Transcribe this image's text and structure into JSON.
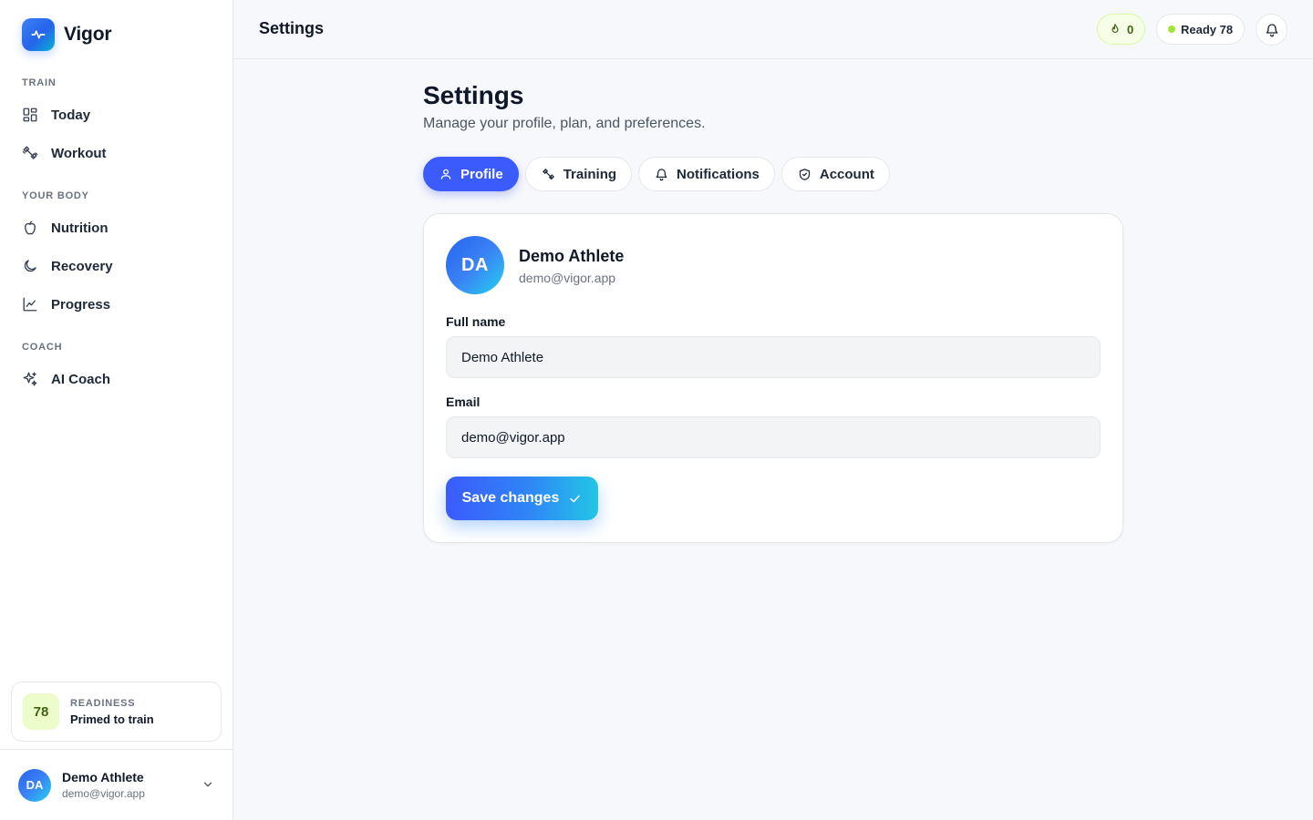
{
  "brand": {
    "name": "Vigor",
    "logo_icon": "pulse-icon"
  },
  "sidebar": {
    "sections": [
      {
        "label": "TRAIN",
        "items": [
          {
            "label": "Today",
            "icon": "grid-icon"
          },
          {
            "label": "Workout",
            "icon": "dumbbell-icon"
          }
        ]
      },
      {
        "label": "YOUR BODY",
        "items": [
          {
            "label": "Nutrition",
            "icon": "apple-icon"
          },
          {
            "label": "Recovery",
            "icon": "moon-icon"
          },
          {
            "label": "Progress",
            "icon": "chart-icon"
          }
        ]
      },
      {
        "label": "COACH",
        "items": [
          {
            "label": "AI Coach",
            "icon": "sparkle-icon"
          }
        ]
      }
    ],
    "readiness": {
      "score": "78",
      "label": "READINESS",
      "status": "Primed to train"
    },
    "user": {
      "initials": "DA",
      "name": "Demo Athlete",
      "email": "demo@vigor.app"
    }
  },
  "topbar": {
    "title": "Settings",
    "streak": "0",
    "ready": "Ready 78"
  },
  "page": {
    "title": "Settings",
    "subtitle": "Manage your profile, plan, and preferences."
  },
  "tabs": [
    {
      "label": "Profile",
      "icon": "user-icon",
      "active": true
    },
    {
      "label": "Training",
      "icon": "dumbbell-icon",
      "active": false
    },
    {
      "label": "Notifications",
      "icon": "bell-icon",
      "active": false
    },
    {
      "label": "Account",
      "icon": "shield-icon",
      "active": false
    }
  ],
  "profile": {
    "initials": "DA",
    "name": "Demo Athlete",
    "email": "demo@vigor.app",
    "full_name_label": "Full name",
    "full_name_value": "Demo Athlete",
    "email_label": "Email",
    "email_value": "demo@vigor.app",
    "save_label": "Save changes"
  },
  "colors": {
    "accent": "#3b5bfd",
    "readiness_bg": "#ecfccb",
    "readiness_dot": "#a3e635"
  }
}
